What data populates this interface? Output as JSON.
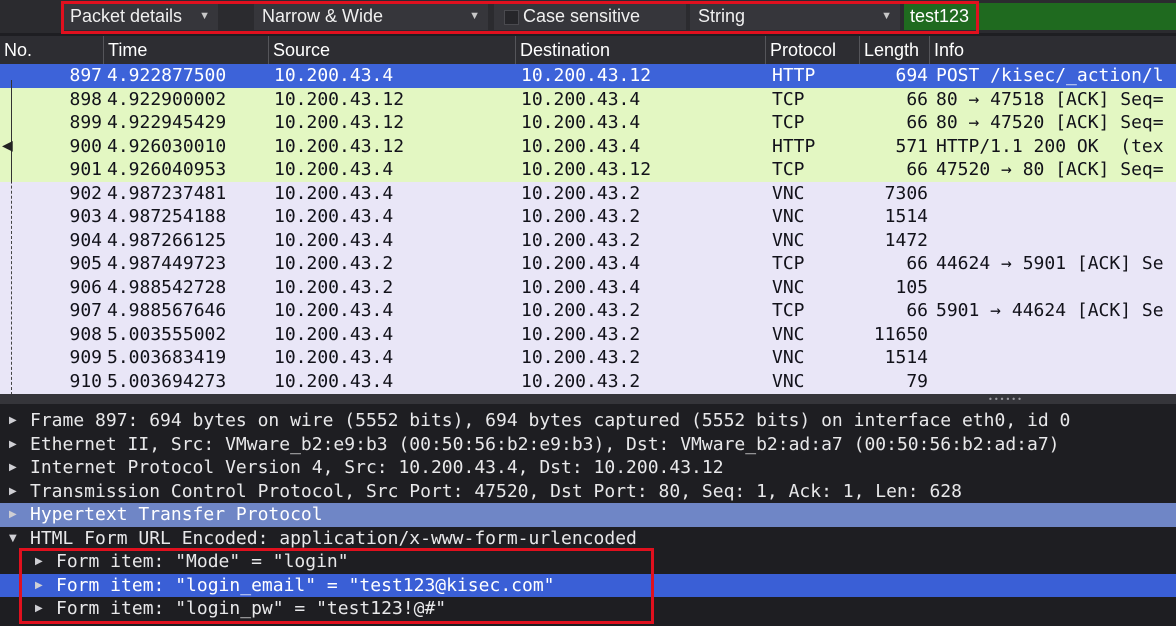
{
  "find_bar": {
    "search_in": "Packet details",
    "char_width": "Narrow & Wide",
    "case_sensitive_label": "Case sensitive",
    "case_sensitive_checked": false,
    "search_type": "String",
    "search_text": "test123"
  },
  "packet_list": {
    "columns": {
      "no": "No.",
      "time": "Time",
      "source": "Source",
      "destination": "Destination",
      "protocol": "Protocol",
      "length": "Length",
      "info": "Info"
    },
    "rows": [
      {
        "no": "897",
        "time": "4.922877500",
        "src": "10.200.43.4",
        "dst": "10.200.43.12",
        "proto": "HTTP",
        "len": "694",
        "info": "POST /kisec/_action/l",
        "kind": "sel"
      },
      {
        "no": "898",
        "time": "4.922900002",
        "src": "10.200.43.12",
        "dst": "10.200.43.4",
        "proto": "TCP",
        "len": "66",
        "info": "80 → 47518 [ACK] Seq=",
        "kind": "tcp"
      },
      {
        "no": "899",
        "time": "4.922945429",
        "src": "10.200.43.12",
        "dst": "10.200.43.4",
        "proto": "TCP",
        "len": "66",
        "info": "80 → 47520 [ACK] Seq=",
        "kind": "tcp"
      },
      {
        "no": "900",
        "time": "4.926030010",
        "src": "10.200.43.12",
        "dst": "10.200.43.4",
        "proto": "HTTP",
        "len": "571",
        "info": "HTTP/1.1 200 OK  (tex",
        "kind": "tcp"
      },
      {
        "no": "901",
        "time": "4.926040953",
        "src": "10.200.43.4",
        "dst": "10.200.43.12",
        "proto": "TCP",
        "len": "66",
        "info": "47520 → 80 [ACK] Seq=",
        "kind": "tcp"
      },
      {
        "no": "902",
        "time": "4.987237481",
        "src": "10.200.43.4",
        "dst": "10.200.43.2",
        "proto": "VNC",
        "len": "7306",
        "info": "",
        "kind": "vnc"
      },
      {
        "no": "903",
        "time": "4.987254188",
        "src": "10.200.43.4",
        "dst": "10.200.43.2",
        "proto": "VNC",
        "len": "1514",
        "info": "",
        "kind": "vnc"
      },
      {
        "no": "904",
        "time": "4.987266125",
        "src": "10.200.43.4",
        "dst": "10.200.43.2",
        "proto": "VNC",
        "len": "1472",
        "info": "",
        "kind": "vnc"
      },
      {
        "no": "905",
        "time": "4.987449723",
        "src": "10.200.43.2",
        "dst": "10.200.43.4",
        "proto": "TCP",
        "len": "66",
        "info": "44624 → 5901 [ACK] Se",
        "kind": "vnc"
      },
      {
        "no": "906",
        "time": "4.988542728",
        "src": "10.200.43.2",
        "dst": "10.200.43.4",
        "proto": "VNC",
        "len": "105",
        "info": "",
        "kind": "vnc"
      },
      {
        "no": "907",
        "time": "4.988567646",
        "src": "10.200.43.4",
        "dst": "10.200.43.2",
        "proto": "TCP",
        "len": "66",
        "info": "5901 → 44624 [ACK] Se",
        "kind": "vnc"
      },
      {
        "no": "908",
        "time": "5.003555002",
        "src": "10.200.43.4",
        "dst": "10.200.43.2",
        "proto": "VNC",
        "len": "11650",
        "info": "",
        "kind": "vnc"
      },
      {
        "no": "909",
        "time": "5.003683419",
        "src": "10.200.43.4",
        "dst": "10.200.43.2",
        "proto": "VNC",
        "len": "1514",
        "info": "",
        "kind": "vnc"
      },
      {
        "no": "910",
        "time": "5.003694273",
        "src": "10.200.43.4",
        "dst": "10.200.43.2",
        "proto": "VNC",
        "len": "79",
        "info": "",
        "kind": "vnc"
      }
    ]
  },
  "details": {
    "items": [
      {
        "text": "Frame 897: 694 bytes on wire (5552 bits), 694 bytes captured (5552 bits) on interface eth0, id 0",
        "indent": 0,
        "expanded": false,
        "state": "none"
      },
      {
        "text": "Ethernet II, Src: VMware_b2:e9:b3 (00:50:56:b2:e9:b3), Dst: VMware_b2:ad:a7 (00:50:56:b2:ad:a7)",
        "indent": 0,
        "expanded": false,
        "state": "none"
      },
      {
        "text": "Internet Protocol Version 4, Src: 10.200.43.4, Dst: 10.200.43.12",
        "indent": 0,
        "expanded": false,
        "state": "none"
      },
      {
        "text": "Transmission Control Protocol, Src Port: 47520, Dst Port: 80, Seq: 1, Ack: 1, Len: 628",
        "indent": 0,
        "expanded": false,
        "state": "none"
      },
      {
        "text": "Hypertext Transfer Protocol",
        "indent": 0,
        "expanded": false,
        "state": "hl2"
      },
      {
        "text": "HTML Form URL Encoded: application/x-www-form-urlencoded",
        "indent": 0,
        "expanded": true,
        "state": "none"
      },
      {
        "text": "Form item: \"Mode\" = \"login\"",
        "indent": 1,
        "expanded": false,
        "state": "none"
      },
      {
        "text": "Form item: \"login_email\" = \"test123@kisec.com\"",
        "indent": 1,
        "expanded": false,
        "state": "hl"
      },
      {
        "text": "Form item: \"login_pw\" = \"test123!@#\"",
        "indent": 1,
        "expanded": false,
        "state": "none"
      }
    ]
  },
  "colors": {
    "selected_row": "#3d63d9",
    "tcp_row": "#e3f7c2",
    "vnc_row": "#e9e6f7",
    "search_match": "#1f6a1f",
    "annotation": "#e0101e"
  }
}
